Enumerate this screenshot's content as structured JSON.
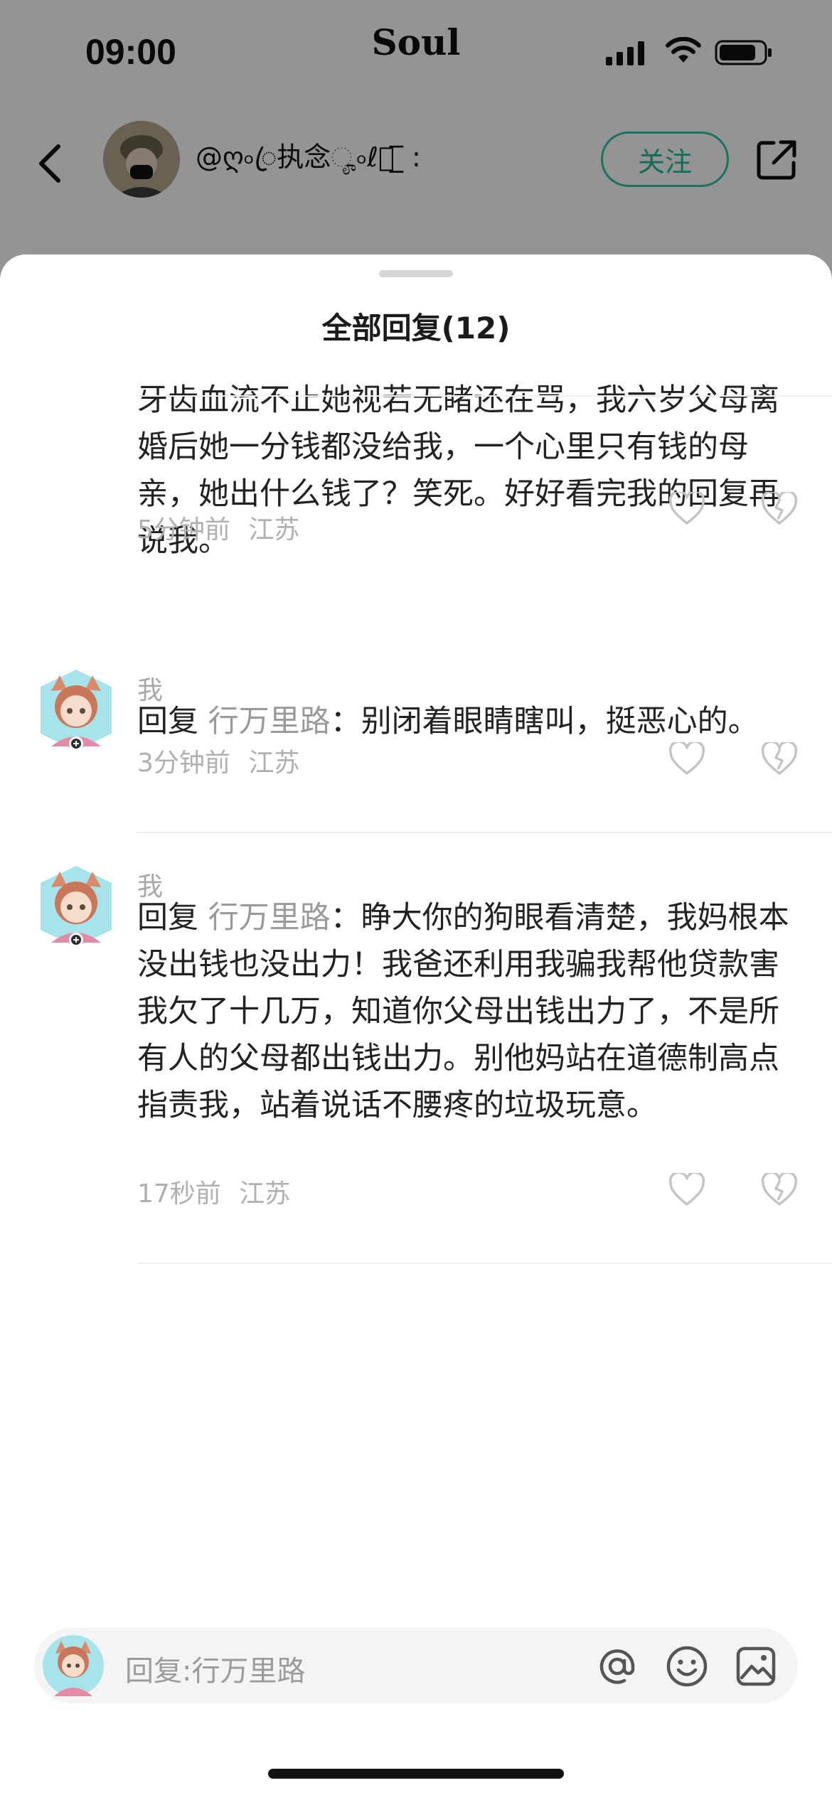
{
  "status_bar": {
    "time": "09:00",
    "carrier": "Soul"
  },
  "nav": {
    "username": "@ღ৹ꦿ执念ೄ৹ℓ⃝ ̲̲̅ :",
    "follow_label": "关注"
  },
  "sheet": {
    "title": "全部回复(12)"
  },
  "comments": [
    {
      "name": "",
      "reply_prefix": "",
      "reply_target": "",
      "body": "牙齿血流不止她视若无睹还在骂，我六岁父母离婚后她一分钱都没给我，一个心里只有钱的母亲，她出什么钱了？笑死。好好看完我的回复再说我。",
      "time": "5分钟前",
      "location": "江苏"
    },
    {
      "name": "我",
      "reply_prefix": "回复 ",
      "reply_target": "行万里路",
      "body": "：别闭着眼睛瞎叫，挺恶心的。",
      "time": "3分钟前",
      "location": "江苏"
    },
    {
      "name": "我",
      "reply_prefix": "回复 ",
      "reply_target": "行万里路",
      "body": "：睁大你的狗眼看清楚，我妈根本没出钱也没出力！我爸还利用我骗我帮他贷款害我欠了十几万，知道你父母出钱出力了，不是所有人的父母都出钱出力。别他妈站在道德制高点指责我，站着说话不腰疼的垃圾玩意。",
      "time": "17秒前",
      "location": "江苏"
    }
  ],
  "input": {
    "placeholder": "回复:行万里路"
  },
  "colors": {
    "accent": "#2cc6a6",
    "meta": "#b0b0b0"
  }
}
